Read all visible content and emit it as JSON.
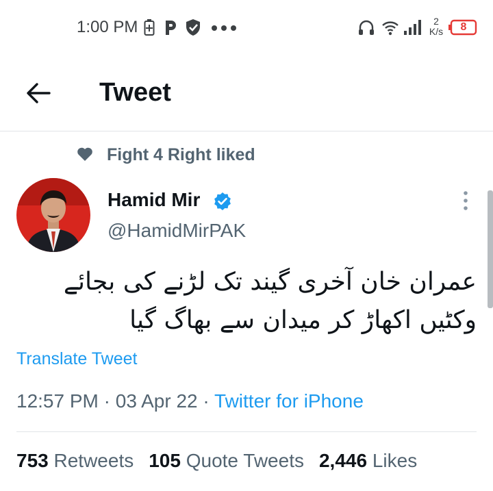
{
  "status_bar": {
    "time": "1:00 PM",
    "icons": [
      "battery-saver-icon",
      "parking-icon",
      "shield-icon",
      "more-dots-icon",
      "headset-icon",
      "wifi-icon",
      "signal-icon",
      "battery-icon"
    ],
    "speed_value": "2",
    "speed_unit": "K/s",
    "battery_level": "8"
  },
  "header": {
    "title": "Tweet",
    "back_icon": "arrow-left-icon"
  },
  "social_context": {
    "icon": "heart-icon",
    "text": "Fight 4 Right liked"
  },
  "author": {
    "name": "Hamid Mir",
    "handle": "@HamidMirPAK",
    "verified": true,
    "menu_icon": "more-vertical-icon"
  },
  "tweet": {
    "lines": [
      "عمران خان آخری گیند تک لڑنے کی بجائے",
      "وکٹیں اکھاڑ کر میدان سے بھاگ گیا"
    ],
    "translate_label": "Translate Tweet",
    "time": "12:57 PM",
    "separator": "·",
    "date": "03 Apr 22",
    "source": "Twitter for iPhone"
  },
  "stats": {
    "retweets_count": "753",
    "retweets_label": "Retweets",
    "quotes_count": "105",
    "quotes_label": "Quote Tweets",
    "likes_count": "2,446",
    "likes_label": "Likes"
  },
  "colors": {
    "accent": "#1d9bf0",
    "text_primary": "#0f1419",
    "text_secondary": "#536471"
  }
}
